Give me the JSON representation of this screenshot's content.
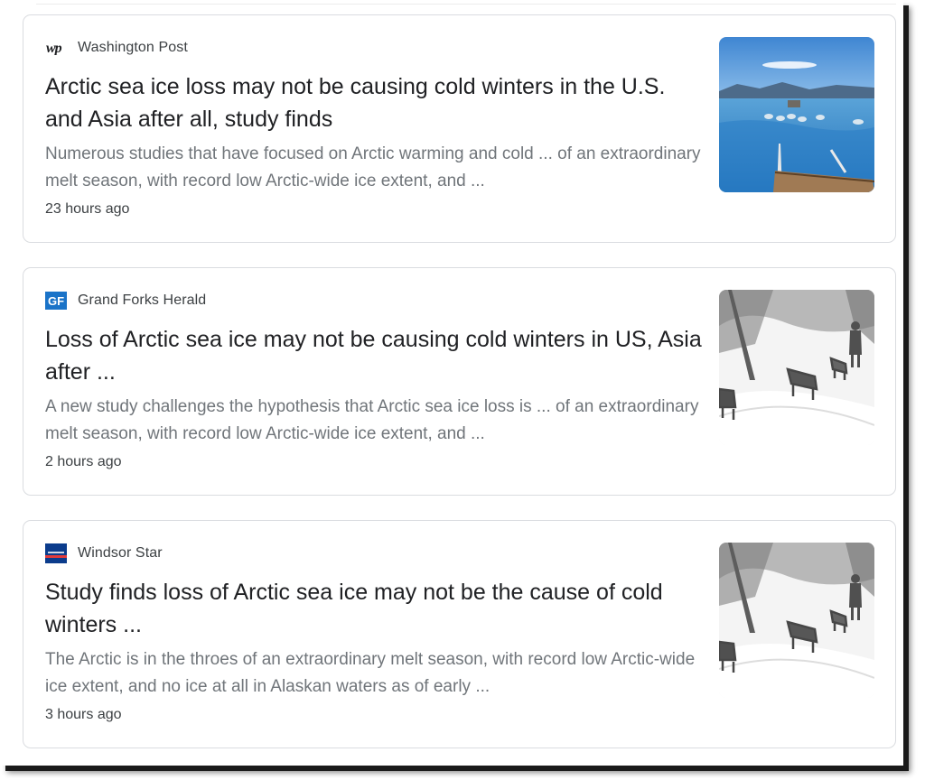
{
  "articles": [
    {
      "source": "Washington Post",
      "logo_icon": "washington-post-logo-icon",
      "headline": "Arctic sea ice loss may not be causing cold winters in the U.S. and Asia after all, study finds",
      "snippet": "Numerous studies that have focused on Arctic warming and cold ... of an extraordinary melt season, with record low Arctic-wide ice extent, and ...",
      "time": "23 hours ago",
      "thumbnail_icon": "sled-dogs-on-meltwater-thumbnail"
    },
    {
      "source": "Grand Forks Herald",
      "logo_icon": "grand-forks-herald-logo-icon",
      "logo_text": "GF",
      "headline": "Loss of Arctic sea ice may not be causing cold winters in US, Asia after ...",
      "snippet": "A new study challenges the hypothesis that Arctic sea ice loss is ... of an extraordinary melt season, with record low Arctic-wide ice extent, and ...",
      "time": "2 hours ago",
      "thumbnail_icon": "snowstorm-park-benches-thumbnail"
    },
    {
      "source": "Windsor Star",
      "logo_icon": "windsor-star-logo-icon",
      "headline": "Study finds loss of Arctic sea ice may not be the cause of cold winters ...",
      "snippet": "The Arctic is in the throes of an extraordinary melt season, with record low Arctic-wide ice extent, and no ice at all in Alaskan waters as of early ...",
      "time": "3 hours ago",
      "thumbnail_icon": "snowstorm-park-benches-thumbnail"
    }
  ],
  "colors": {
    "headline": "#202124",
    "snippet": "#70757a",
    "meta": "#3c4043",
    "border": "#dadce0",
    "gf_logo": "#1a73c8",
    "windsor_logo": "#0b3c8c"
  }
}
